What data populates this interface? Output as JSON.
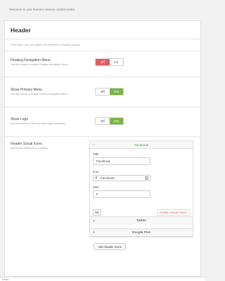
{
  "welcome_text": "Welcome to your theme's mission control center.",
  "section": {
    "title": "Header",
    "intro": "From here, you can control the elements of header section."
  },
  "options": [
    {
      "label": "Floating Navigation Menu",
      "desc": "Use this button to enable Floating Navigation Menu.",
      "off": "Off",
      "on": "On",
      "state": "off"
    },
    {
      "label": "Show Primary Menu",
      "desc": "Use this button to enable Primary Navigation Menu.",
      "off": "Off",
      "on": "ON",
      "state": "on"
    },
    {
      "label": "Show Logo",
      "desc": "Use this button to Show or Hide Logo completely.",
      "off": "Off",
      "on": "ON",
      "state": "on"
    }
  ],
  "social": {
    "label": "Header Social Icons",
    "desc": "Add Social Media icons in header.",
    "expanded": {
      "sign": "−",
      "title": "Facebook",
      "title_field_label": "Title",
      "title_field_value": "Facebook",
      "icon_field_label": "Icon",
      "icon_value": "Facebook",
      "icon_glyph": "f",
      "url_field_label": "URL",
      "url_value": "#",
      "ok_label": "OK",
      "delete_label": "Delete Header Icons"
    },
    "collapsed": [
      {
        "sign": "+",
        "title": "Twitter"
      },
      {
        "sign": "+",
        "title": "Google Plus"
      }
    ],
    "add_label": "Add Header Icons"
  },
  "footer_text": "Reset",
  "colors": {
    "off_active": "#e35b5b",
    "on_active": "#7cb342",
    "facebook_title": "#4a9a4a"
  }
}
